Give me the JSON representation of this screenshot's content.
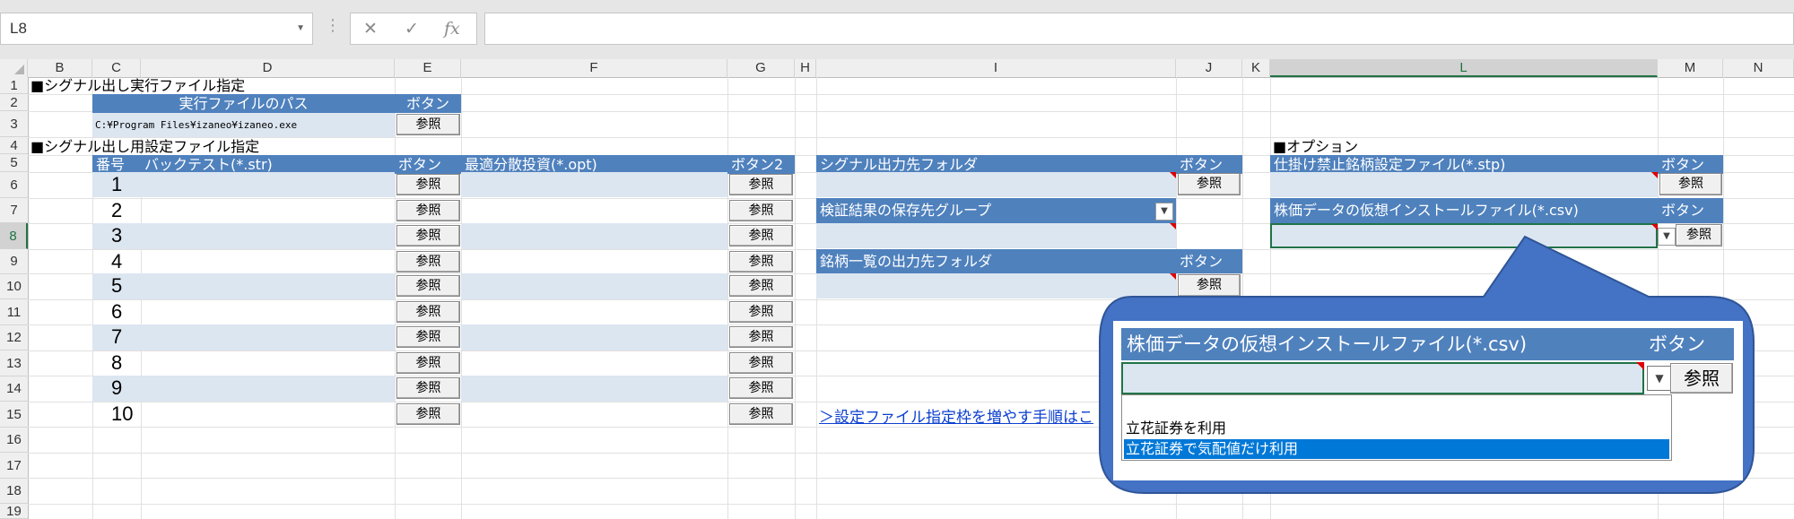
{
  "formula_bar": {
    "name_box": "L8",
    "cancel_icon": "✕",
    "enter_icon": "✓",
    "fx_icon": "fx",
    "formula": ""
  },
  "columns": [
    "B",
    "C",
    "D",
    "E",
    "F",
    "G",
    "H",
    "I",
    "J",
    "K",
    "L",
    "M",
    "N"
  ],
  "rows": [
    "1",
    "2",
    "3",
    "4",
    "5",
    "6",
    "7",
    "8",
    "9",
    "10",
    "11",
    "12",
    "13",
    "14",
    "15",
    "16",
    "17",
    "18",
    "19"
  ],
  "sheet": {
    "section1_title": "■シグナル出し実行ファイル指定",
    "exec_header_path": "実行ファイルのパス",
    "exec_header_button": "ボタン",
    "exec_path": "C:¥Program Files¥izaneo¥izaneo.exe",
    "section2_title": "■シグナル出し用設定ファイル指定",
    "table_header": {
      "num": "番号",
      "backtest": "バックテスト(*.str)",
      "button": "ボタン",
      "optimal": "最適分散投資(*.opt)",
      "button2": "ボタン2"
    },
    "row_numbers": [
      "1",
      "2",
      "3",
      "4",
      "5",
      "6",
      "7",
      "8",
      "9",
      "10"
    ],
    "browse_label": "参照",
    "signal_folder_header": "シグナル出力先フォルダ",
    "signal_folder_button": "ボタン",
    "verify_group_header": "検証結果の保存先グループ",
    "stock_list_header": "銘柄一覧の出力先フォルダ",
    "stock_list_button": "ボタン",
    "howto_link": "＞設定ファイル指定枠を増やす手順はこ",
    "option_title": "■オプション",
    "ban_file_header": "仕掛け禁止銘柄設定ファイル(*.stp)",
    "ban_file_button": "ボタン",
    "install_header": "株価データの仮想インストールファイル(*.csv)",
    "install_button": "ボタン"
  },
  "callout": {
    "header": "株価データの仮想インストールファイル(*.csv)",
    "header_button": "ボタン",
    "browse_label": "参照",
    "dropdown_icon": "chevron-down",
    "options": [
      "",
      "立花証券を利用",
      "立花証券で気配値だけ利用"
    ],
    "selected_index": 2
  },
  "colors": {
    "header_blue": "#4f81bd",
    "band_fill": "#dce6f1",
    "callout_fill": "#4472c4",
    "callout_border": "#2f5597",
    "selection_blue": "#0078d7",
    "excel_green": "#217346"
  }
}
